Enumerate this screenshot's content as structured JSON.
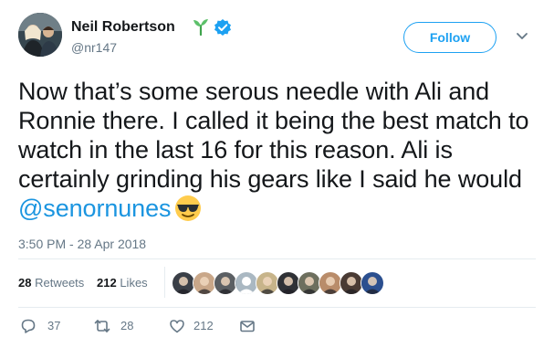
{
  "user": {
    "name": "Neil Robertson",
    "handle": "@nr147",
    "badges": [
      "sprout-icon",
      "verified-badge-icon"
    ]
  },
  "follow_button": {
    "label": "Follow"
  },
  "tweet": {
    "text_before": "Now that’s some serous needle with Ali and Ronnie there. I called it being the best match to watch in the last 16 for this reason. Ali is certainly grinding his gears like I said he would ",
    "mention": "@senornunes",
    "emoji": "smiling-face-with-sunglasses"
  },
  "timestamp": "3:50 PM - 28 Apr 2018",
  "stats": {
    "retweets_count": "28",
    "retweets_label": "Retweets",
    "likes_count": "212",
    "likes_label": "Likes"
  },
  "likers": [
    {
      "icon": "avatar-1",
      "color": "#3a3f47"
    },
    {
      "icon": "avatar-2",
      "color": "#c9a789"
    },
    {
      "icon": "avatar-3",
      "color": "#5b5f63"
    },
    {
      "icon": "avatar-default",
      "color": "#aab8c2"
    },
    {
      "icon": "avatar-5",
      "color": "#c7b48a"
    },
    {
      "icon": "avatar-6",
      "color": "#2f3136"
    },
    {
      "icon": "avatar-7",
      "color": "#6d6f5e"
    },
    {
      "icon": "avatar-8",
      "color": "#b98c6a"
    },
    {
      "icon": "avatar-9",
      "color": "#4a3b34"
    },
    {
      "icon": "avatar-10",
      "color": "#2b4f8f"
    }
  ],
  "actions": {
    "replies": "37",
    "retweets": "28",
    "likes": "212"
  },
  "colors": {
    "accent": "#1da1f2",
    "link": "#1b95e0",
    "muted": "#657786",
    "divider": "#e6ecf0"
  }
}
